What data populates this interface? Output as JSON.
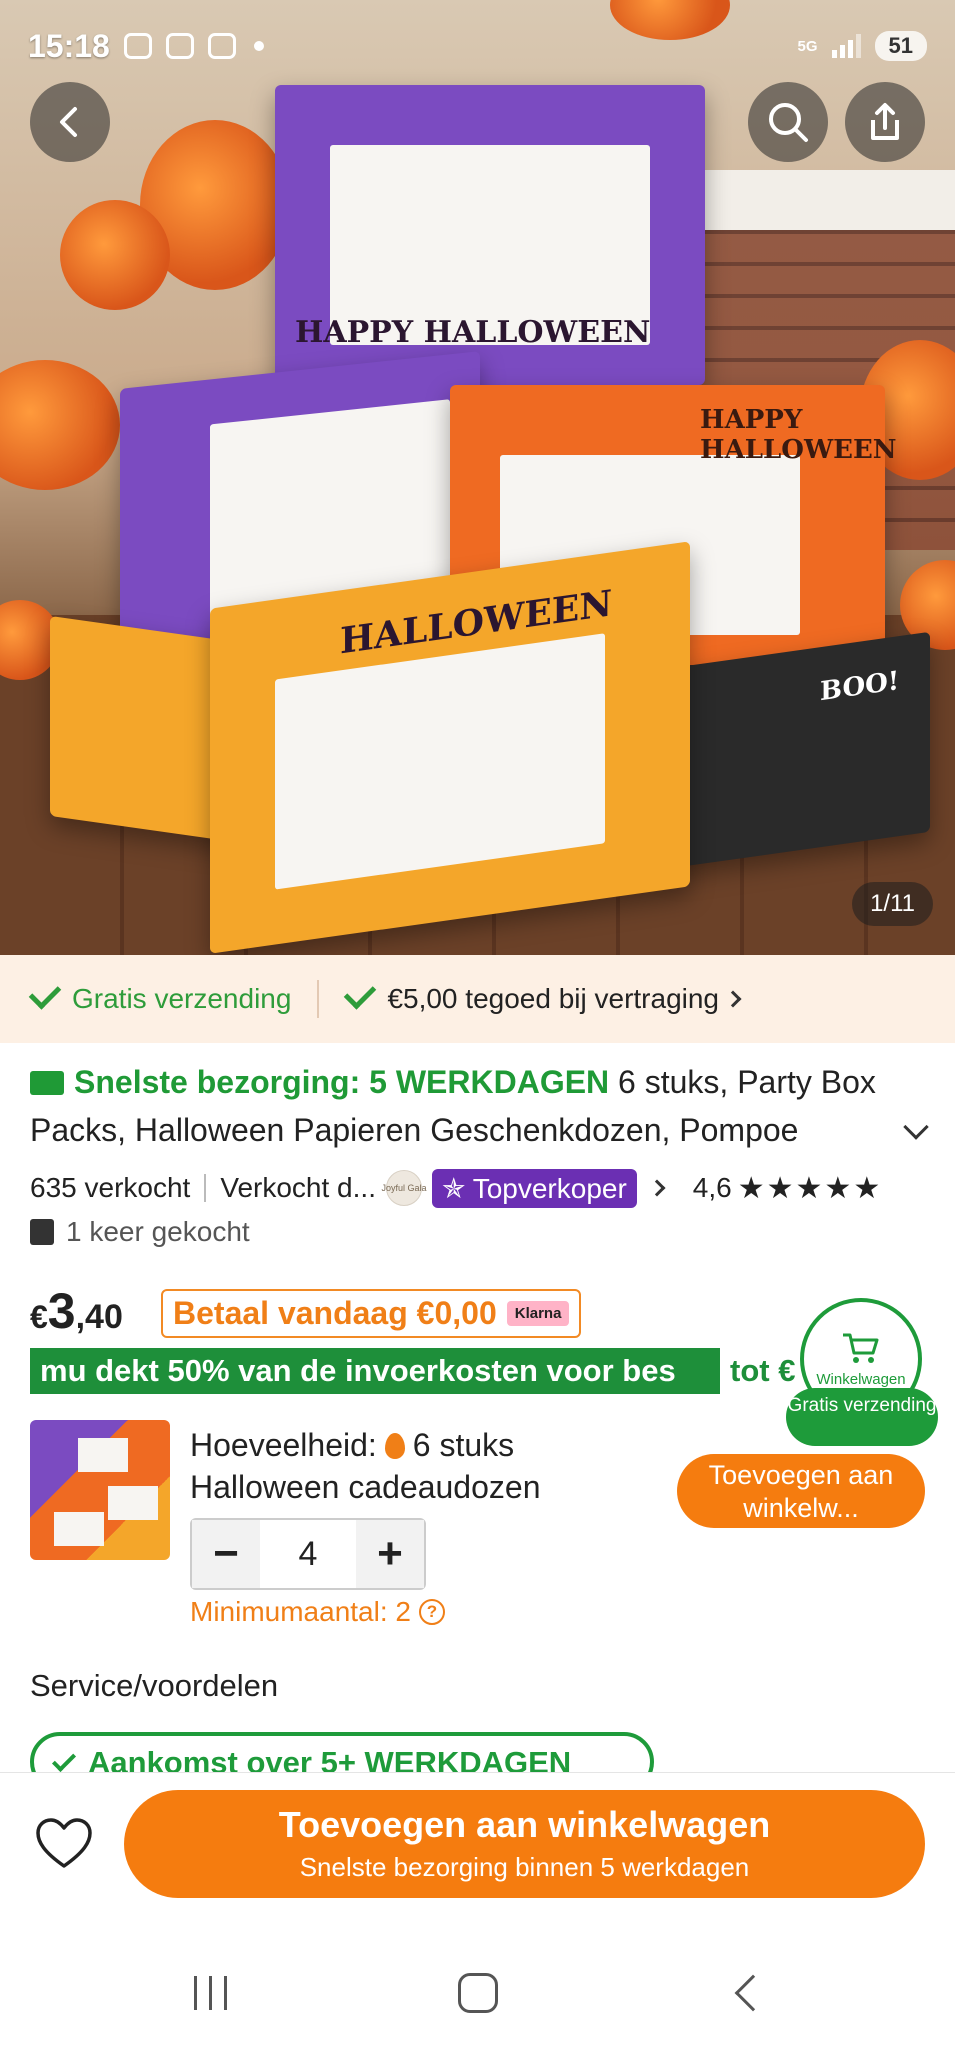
{
  "status_bar": {
    "time": "15:18",
    "network": "5G",
    "battery": "51"
  },
  "gallery": {
    "counter": "1/11",
    "box_text_1": "HAPPY HALLOWEEN",
    "box_text_2": "HAPPY HALLOWEEN",
    "box_text_3": "HALLOWEEN",
    "box_text_4": "BOO!"
  },
  "benefits": {
    "free_shipping": "Gratis verzending",
    "credit": "€5,00 tegoed bij vertraging"
  },
  "product": {
    "speed_label": "Snelste bezorging: 5 WERKDAGEN",
    "title": "6 stuks, Party Box Packs, Halloween Papieren Geschenkdozen, Pompoe",
    "sold": "635 verkocht",
    "sold_by": "Verkocht d...",
    "seller_logo_text": "Joyful Gala",
    "top_seller": "Topverkoper",
    "rating": "4,6",
    "stars": "★★★★★",
    "bought": "1 keer gekocht"
  },
  "price": {
    "currency": "€",
    "whole": "3",
    "decimal": ",40",
    "pay_today": "Betaal vandaag €0,00",
    "klarna": "Klarna",
    "promo": "mu dekt 50% van de invoerkosten voor bes",
    "promo_tail": "tot €"
  },
  "cart_badge": {
    "label": "Winkelwagen",
    "pill": "Gratis verzending"
  },
  "quantity": {
    "label": "Hoeveelheid:",
    "option": "6 stuks Halloween cadeaudozen",
    "value": "4",
    "minus": "−",
    "plus": "+",
    "minimum": "Minimumaantal: 2",
    "help": "?",
    "add_button": "Toevoegen aan winkelw..."
  },
  "service": {
    "heading": "Service/voordelen",
    "arrival": "Aankomst over 5+ WERKDAGEN"
  },
  "bottom": {
    "add_to_cart": "Toevoegen aan winkelwagen",
    "delivery_note": "Snelste bezorging binnen 5 werkdagen"
  },
  "colors": {
    "accent_orange": "#f57c0f",
    "green": "#1e9b3a",
    "purple": "#6b2fb3"
  }
}
